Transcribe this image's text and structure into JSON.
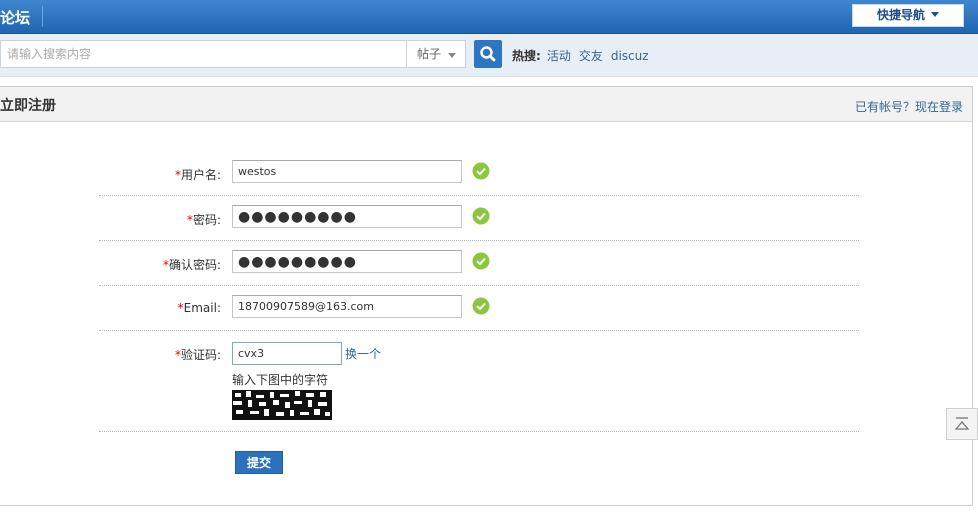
{
  "header": {
    "site_title": "论坛",
    "quick_nav_label": "快捷导航"
  },
  "search": {
    "placeholder": "请输入搜索内容",
    "type_label": "帖子",
    "hot_label": "热搜:",
    "hot_links": [
      "活动",
      "交友",
      "discuz"
    ]
  },
  "register": {
    "title": "立即注册",
    "login_link": "已有帐号？现在登录",
    "required_mark": "*",
    "username": {
      "label": "用户名:",
      "value": "westos"
    },
    "password": {
      "label": "密码:",
      "value": "●●●●●●●●●"
    },
    "confirm_password": {
      "label": "确认密码:",
      "value": "●●●●●●●●●"
    },
    "email": {
      "label": "Email:",
      "value": "18700907589@163.com"
    },
    "captcha": {
      "label": "验证码:",
      "value": "cvx3",
      "change_link": "换一个",
      "hint": "输入下图中的字符"
    },
    "submit_label": "提交"
  },
  "colors": {
    "header_blue": "#1f65b0",
    "link_blue": "#336699",
    "ok_green": "#8cc63f",
    "required_red": "#ee0000"
  },
  "icons": {
    "search": "search-icon",
    "ok": "check-circle-icon",
    "back_to_top": "back-to-top-icon"
  }
}
